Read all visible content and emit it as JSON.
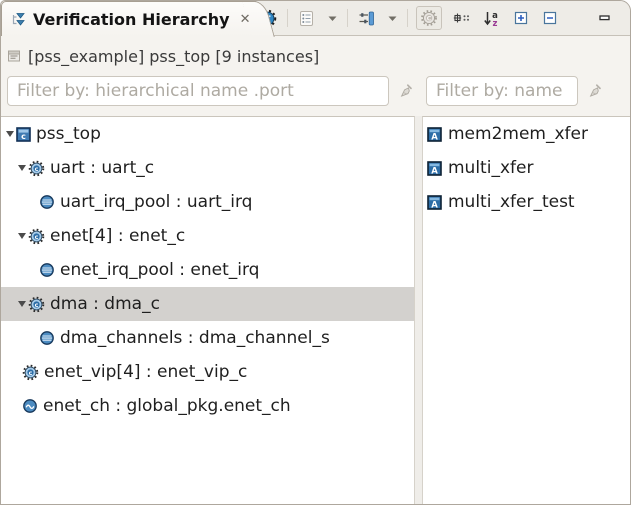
{
  "tab": {
    "title": "Verification Hierarchy",
    "close_glyph": "✕",
    "icon": "hierarchy-icon"
  },
  "header": {
    "text": "[pss_example] pss_top [9 instances]",
    "icon": "module-icon"
  },
  "filters": {
    "tree_filter": {
      "placeholder": "Filter by: hierarchical name .port",
      "value": "",
      "clear_icon": "broom-icon"
    },
    "list_filter": {
      "placeholder": "Filter by: name",
      "value": "",
      "clear_icon": "broom-icon"
    }
  },
  "toolbar": {
    "groups": [
      {
        "buttons": [
          {
            "name": "verification-test-button",
            "icon": "bug-t-icon",
            "disabled": false,
            "framed": false
          }
        ]
      },
      {
        "buttons": [
          {
            "name": "outline-view-button",
            "icon": "checklist-icon",
            "disabled": false,
            "framed": false
          },
          {
            "name": "outline-menu-button",
            "icon": "dropdown-arrow-icon",
            "disabled": false,
            "framed": false
          }
        ]
      },
      {
        "buttons": [
          {
            "name": "view-filters-button",
            "icon": "sliders-icon",
            "disabled": false,
            "framed": false
          },
          {
            "name": "view-filters-menu-button",
            "icon": "dropdown-arrow-icon",
            "disabled": false,
            "framed": false
          }
        ]
      },
      {
        "buttons": [
          {
            "name": "component-mode-toggle",
            "icon": "gear-c-disabled-icon",
            "disabled": true,
            "framed": true
          },
          {
            "name": "show-ports-button",
            "icon": "ports-icon",
            "disabled": false,
            "framed": false
          },
          {
            "name": "sort-alphabetical-button",
            "icon": "sort-az-icon",
            "disabled": false,
            "framed": false
          },
          {
            "name": "expand-all-button",
            "icon": "expand-all-icon",
            "disabled": false,
            "framed": false
          },
          {
            "name": "collapse-all-button",
            "icon": "collapse-all-icon",
            "disabled": false,
            "framed": false
          }
        ]
      }
    ],
    "window_buttons": [
      {
        "name": "minimize-view-button",
        "icon": "minimize-icon"
      },
      {
        "name": "maximize-view-button",
        "icon": "maximize-icon"
      }
    ]
  },
  "tree": {
    "items": [
      {
        "label": "pss_top",
        "icon": "component-icon",
        "level": 0,
        "expander": true,
        "expanded": true,
        "selected": false
      },
      {
        "label": "uart : uart_c",
        "icon": "gear-c-icon",
        "level": 1,
        "expander": true,
        "expanded": true,
        "selected": false
      },
      {
        "label": "uart_irq_pool : uart_irq",
        "icon": "pool-icon",
        "level": 2,
        "expander": false,
        "expanded": false,
        "selected": false
      },
      {
        "label": "enet[4] : enet_c",
        "icon": "gear-c-icon",
        "level": 1,
        "expander": true,
        "expanded": true,
        "selected": false
      },
      {
        "label": "enet_irq_pool : enet_irq",
        "icon": "pool-icon",
        "level": 2,
        "expander": false,
        "expanded": false,
        "selected": false
      },
      {
        "label": "dma : dma_c",
        "icon": "gear-c-icon",
        "level": 1,
        "expander": true,
        "expanded": true,
        "selected": true
      },
      {
        "label": "dma_channels : dma_channel_s",
        "icon": "pool-icon",
        "level": 2,
        "expander": false,
        "expanded": false,
        "selected": false
      },
      {
        "label": "enet_vip[4] : enet_vip_c",
        "icon": "gear-c-icon",
        "level": 1,
        "expander": false,
        "expanded": false,
        "selected": false
      },
      {
        "label": "enet_ch : global_pkg.enet_ch",
        "icon": "channel-icon",
        "level": 1,
        "expander": false,
        "expanded": false,
        "selected": false
      }
    ]
  },
  "action_list": {
    "items": [
      {
        "label": "mem2mem_xfer",
        "icon": "action-icon"
      },
      {
        "label": "multi_xfer",
        "icon": "action-icon"
      },
      {
        "label": "multi_xfer_test",
        "icon": "action-icon"
      }
    ]
  },
  "colors": {
    "chrome_background": "#efede9",
    "panel_background": "#ffffff",
    "selection_background": "#d3d1ce",
    "icon_blue": "#2d6da6",
    "icon_light_blue": "#9fc6e8",
    "sort_z_purple": "#9a3a94",
    "placeholder_gray": "#aeaaa2"
  }
}
